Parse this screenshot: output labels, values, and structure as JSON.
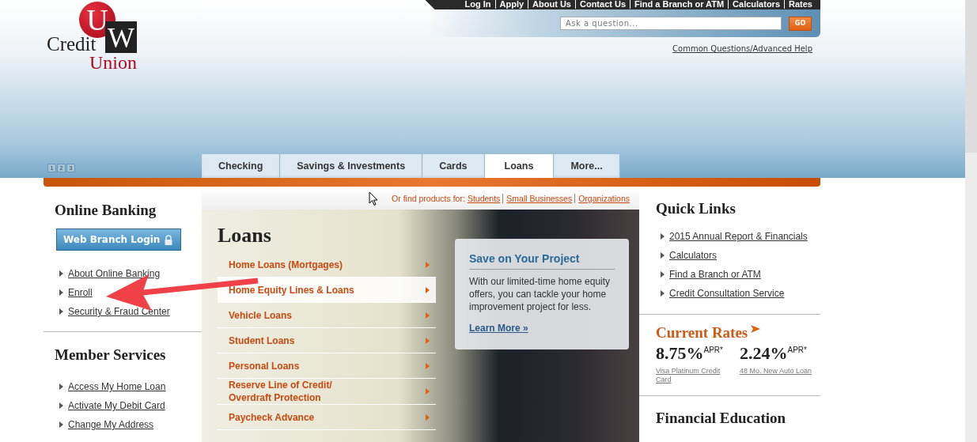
{
  "utility_nav": [
    "Log In",
    "Apply",
    "About Us",
    "Contact Us",
    "Find a Branch or ATM",
    "Calculators",
    "Rates"
  ],
  "logo": {
    "letters": "UW",
    "line1": "Credit",
    "line2": "Union"
  },
  "search": {
    "placeholder": "Ask a question...",
    "button": "GO"
  },
  "help_link": "Common Questions/Advanced Help",
  "slide_pager": [
    "1",
    "2",
    "3"
  ],
  "tabs": [
    {
      "label": "Checking",
      "selected": false
    },
    {
      "label": "Savings & Investments",
      "selected": false
    },
    {
      "label": "Cards",
      "selected": false
    },
    {
      "label": "Loans",
      "selected": true
    },
    {
      "label": "More...",
      "selected": false
    }
  ],
  "online_banking": {
    "title": "Online Banking",
    "login_button": "Web Branch Login",
    "links": [
      "About Online Banking",
      "Enroll",
      "Security & Fraud Center"
    ]
  },
  "member_services": {
    "title": "Member Services",
    "links": [
      "Access My Home Loan",
      "Activate My Debit Card",
      "Change My Address"
    ]
  },
  "find_products": {
    "label": "Or find products for:",
    "links": [
      "Students",
      "Small Businesses",
      "Organizations"
    ]
  },
  "loans_menu": {
    "title": "Loans",
    "items": [
      {
        "label": "Home Loans (Mortgages)",
        "selected": false
      },
      {
        "label": "Home Equity Lines & Loans",
        "selected": true
      },
      {
        "label": "Vehicle Loans",
        "selected": false
      },
      {
        "label": "Student Loans",
        "selected": false
      },
      {
        "label": "Personal Loans",
        "selected": false
      },
      {
        "label": "Reserve Line of Credit/\nOverdraft Protection",
        "selected": false
      },
      {
        "label": "Paycheck Advance",
        "selected": false
      }
    ]
  },
  "promo": {
    "title": "Save on Your Project",
    "text": "With our limited-time home equity offers, you can tackle your home improvement project for less.",
    "link": "Learn More »"
  },
  "quick_links": {
    "title": "Quick Links",
    "links": [
      "2015 Annual Report & Financials",
      "Calculators",
      "Find a Branch or ATM",
      "Credit Consultation Service"
    ]
  },
  "current_rates": {
    "title": "Current Rates",
    "rates": [
      {
        "value": "8.75%",
        "suffix": "APR*",
        "label": "Visa Platinum Credit Card"
      },
      {
        "value": "2.24%",
        "suffix": "APR*",
        "label": "48 Mo. New Auto Loan"
      }
    ]
  },
  "financial_education": {
    "title": "Financial Education"
  }
}
